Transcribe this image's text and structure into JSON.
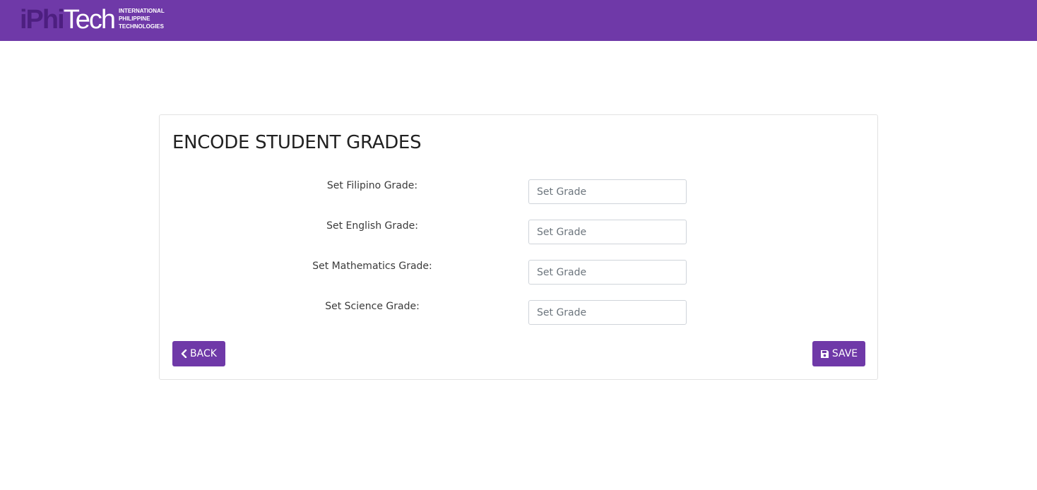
{
  "brand": {
    "logo_dark": "iPhi",
    "logo_light": "Tech",
    "logo_sub_1": "INTERNATIONAL",
    "logo_sub_2": "PHILIPPINE",
    "logo_sub_3": "TECHNOLOGIES",
    "color": "#6f39a8"
  },
  "form": {
    "title": "ENCODE STUDENT GRADES",
    "fields": [
      {
        "label": "Set Filipino Grade:",
        "placeholder": "Set Grade",
        "value": ""
      },
      {
        "label": "Set English Grade:",
        "placeholder": "Set Grade",
        "value": ""
      },
      {
        "label": "Set Mathematics Grade:",
        "placeholder": "Set Grade",
        "value": ""
      },
      {
        "label": "Set Science Grade:",
        "placeholder": "Set Grade",
        "value": ""
      }
    ],
    "back_label": "BACK",
    "save_label": "SAVE",
    "back_icon": "chevron-left-icon",
    "save_icon": "floppy-disk-icon"
  }
}
